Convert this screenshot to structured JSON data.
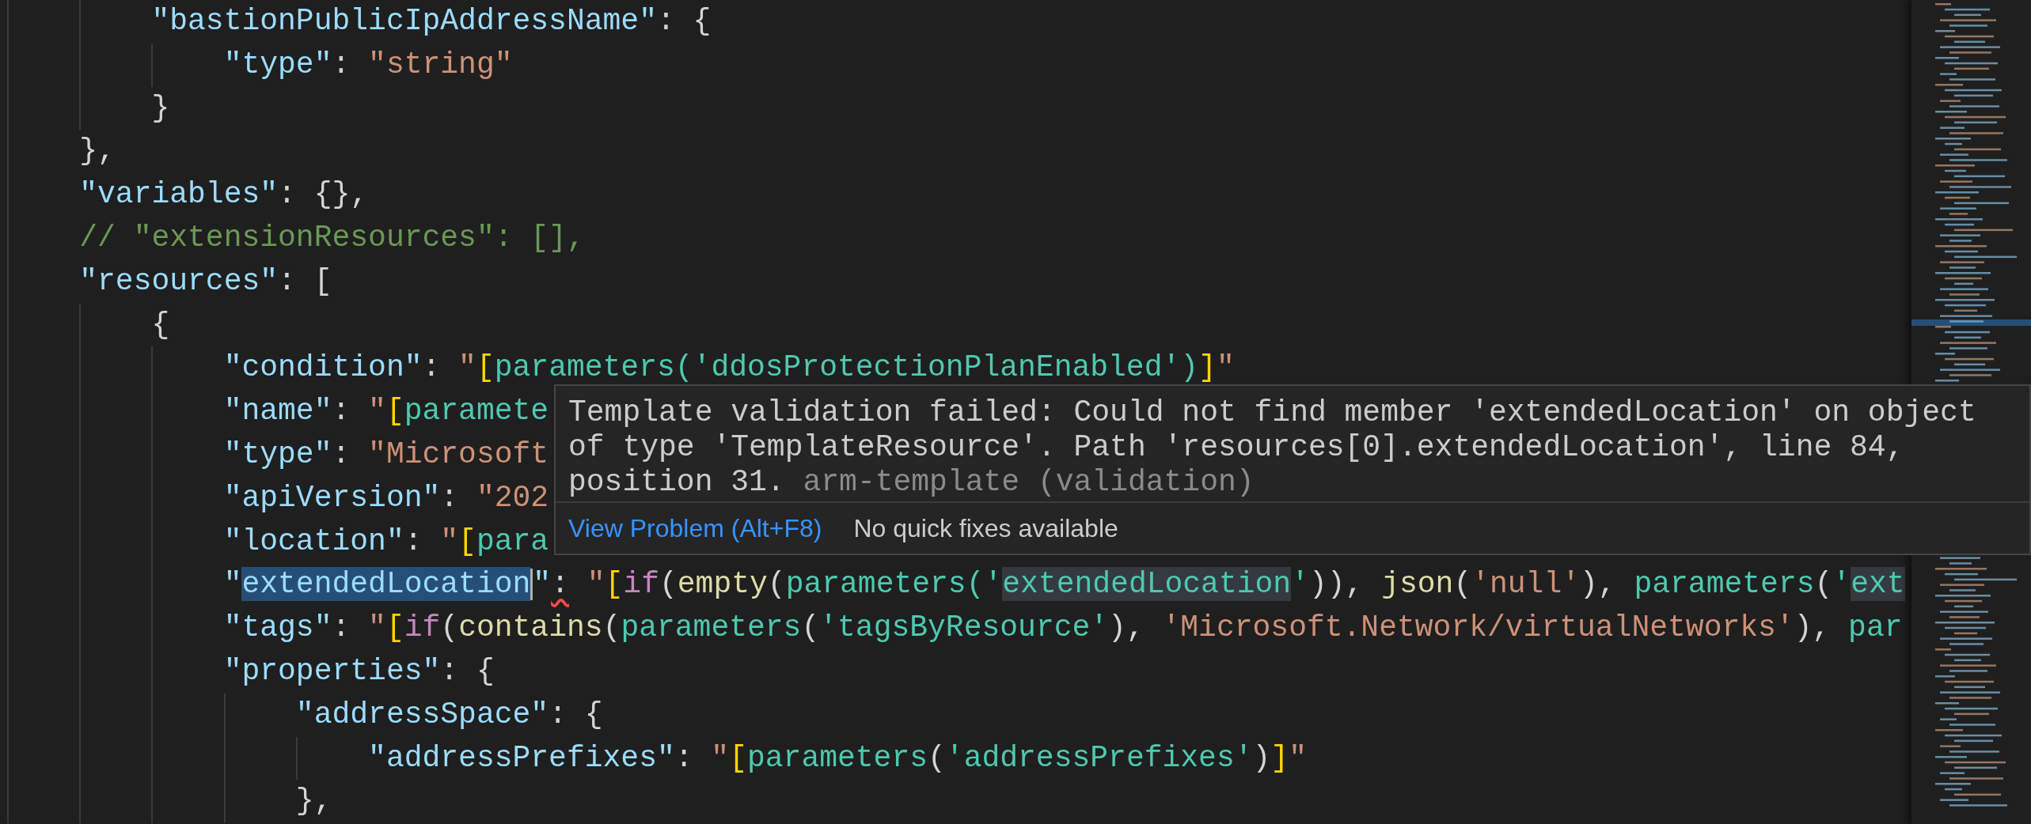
{
  "editor": {
    "lines": [
      {
        "tokens": [
          {
            "text": "        \"bastionPublicIpAddressName\"",
            "kind": "key"
          },
          {
            "text": ": {",
            "kind": "punct"
          }
        ]
      },
      {
        "tokens": [
          {
            "text": "            \"type\"",
            "kind": "key"
          },
          {
            "text": ": ",
            "kind": "punct"
          },
          {
            "text": "\"string\"",
            "kind": "str"
          }
        ]
      },
      {
        "tokens": [
          {
            "text": "        }",
            "kind": "punct"
          }
        ]
      },
      {
        "tokens": [
          {
            "text": "    },",
            "kind": "punct"
          }
        ]
      },
      {
        "tokens": [
          {
            "text": "    \"variables\"",
            "kind": "key"
          },
          {
            "text": ": {},",
            "kind": "punct"
          }
        ]
      },
      {
        "tokens": [
          {
            "text": "    // \"extensionResources\": [],",
            "kind": "comment"
          }
        ]
      },
      {
        "tokens": [
          {
            "text": "    \"resources\"",
            "kind": "key"
          },
          {
            "text": ": [",
            "kind": "punct"
          }
        ]
      },
      {
        "tokens": [
          {
            "text": "        {",
            "kind": "punct"
          }
        ]
      },
      {
        "tokens": [
          {
            "text": "            \"condition\"",
            "kind": "key"
          },
          {
            "text": ": ",
            "kind": "punct"
          },
          {
            "text": "\"",
            "kind": "str"
          },
          {
            "text": "[",
            "kind": "bracket"
          },
          {
            "text": "parameters('ddosProtectionPlanEnabled')",
            "kind": "expr"
          },
          {
            "text": "]",
            "kind": "bracket"
          },
          {
            "text": "\"",
            "kind": "str"
          }
        ]
      },
      {
        "tokens": [
          {
            "text": "            \"name\"",
            "kind": "key"
          },
          {
            "text": ": ",
            "kind": "punct"
          },
          {
            "text": "\"",
            "kind": "str"
          },
          {
            "text": "[",
            "kind": "bracket"
          },
          {
            "text": "paramete",
            "kind": "expr"
          }
        ]
      },
      {
        "tokens": [
          {
            "text": "            \"type\"",
            "kind": "key"
          },
          {
            "text": ": ",
            "kind": "punct"
          },
          {
            "text": "\"Microsoft",
            "kind": "str"
          }
        ]
      },
      {
        "tokens": [
          {
            "text": "            \"apiVersion\"",
            "kind": "key"
          },
          {
            "text": ": ",
            "kind": "punct"
          },
          {
            "text": "\"202",
            "kind": "str"
          }
        ]
      },
      {
        "tokens": [
          {
            "text": "            \"location\"",
            "kind": "key"
          },
          {
            "text": ": ",
            "kind": "punct"
          },
          {
            "text": "\"",
            "kind": "str"
          },
          {
            "text": "[",
            "kind": "bracket"
          },
          {
            "text": "para",
            "kind": "expr"
          }
        ]
      },
      {
        "tokens": [
          {
            "text": "            \"",
            "kind": "key"
          },
          {
            "text": "extendedLocation",
            "kind": "key",
            "selected": true,
            "cursor": true
          },
          {
            "text": "\"",
            "kind": "key"
          },
          {
            "text": ":",
            "kind": "punct",
            "error": true
          },
          {
            "text": " \"",
            "kind": "str"
          },
          {
            "text": "[",
            "kind": "bracket"
          },
          {
            "text": "if",
            "kind": "kw"
          },
          {
            "text": "(",
            "kind": "punct"
          },
          {
            "text": "empty",
            "kind": "fn"
          },
          {
            "text": "(",
            "kind": "punct"
          },
          {
            "text": "parameters",
            "kind": "expr"
          },
          {
            "text": "('",
            "kind": "expr"
          },
          {
            "text": "extendedLocation",
            "kind": "expr",
            "highlighted": true
          },
          {
            "text": "'",
            "kind": "expr"
          },
          {
            "text": ")), ",
            "kind": "punct"
          },
          {
            "text": "json",
            "kind": "fn"
          },
          {
            "text": "(",
            "kind": "punct"
          },
          {
            "text": "'null'",
            "kind": "str"
          },
          {
            "text": "), ",
            "kind": "punct"
          },
          {
            "text": "parameters",
            "kind": "expr"
          },
          {
            "text": "(",
            "kind": "punct"
          },
          {
            "text": "'",
            "kind": "expr"
          },
          {
            "text": "ext",
            "kind": "expr",
            "highlighted": true
          }
        ]
      },
      {
        "tokens": [
          {
            "text": "            \"tags\"",
            "kind": "key"
          },
          {
            "text": ": ",
            "kind": "punct"
          },
          {
            "text": "\"",
            "kind": "str"
          },
          {
            "text": "[",
            "kind": "bracket"
          },
          {
            "text": "if",
            "kind": "kw"
          },
          {
            "text": "(",
            "kind": "punct"
          },
          {
            "text": "contains",
            "kind": "fn"
          },
          {
            "text": "(",
            "kind": "punct"
          },
          {
            "text": "parameters",
            "kind": "expr"
          },
          {
            "text": "(",
            "kind": "punct"
          },
          {
            "text": "'tagsByResource'",
            "kind": "expr"
          },
          {
            "text": "), ",
            "kind": "punct"
          },
          {
            "text": "'Microsoft.Network/virtualNetworks'",
            "kind": "str"
          },
          {
            "text": "), ",
            "kind": "punct"
          },
          {
            "text": "par",
            "kind": "expr"
          }
        ]
      },
      {
        "tokens": [
          {
            "text": "            \"properties\"",
            "kind": "key"
          },
          {
            "text": ": {",
            "kind": "punct"
          }
        ]
      },
      {
        "tokens": [
          {
            "text": "                \"addressSpace\"",
            "kind": "key"
          },
          {
            "text": ": {",
            "kind": "punct"
          }
        ]
      },
      {
        "tokens": [
          {
            "text": "                    \"addressPrefixes\"",
            "kind": "key"
          },
          {
            "text": ": ",
            "kind": "punct"
          },
          {
            "text": "\"",
            "kind": "str"
          },
          {
            "text": "[",
            "kind": "bracket"
          },
          {
            "text": "parameters",
            "kind": "expr"
          },
          {
            "text": "(",
            "kind": "punct"
          },
          {
            "text": "'addressPrefixes'",
            "kind": "expr"
          },
          {
            "text": ")",
            "kind": "punct"
          },
          {
            "text": "]",
            "kind": "bracket"
          },
          {
            "text": "\"",
            "kind": "str"
          }
        ]
      },
      {
        "tokens": [
          {
            "text": "                },",
            "kind": "punct"
          }
        ]
      }
    ]
  },
  "hover": {
    "message": "Template validation failed: Could not find member 'extendedLocation' on object of type 'TemplateResource'. Path 'resources[0].extendedLocation', line 84, position 31.",
    "source": "arm-template (validation)",
    "action": "View Problem (Alt+F8)",
    "note": "No quick fixes available"
  }
}
